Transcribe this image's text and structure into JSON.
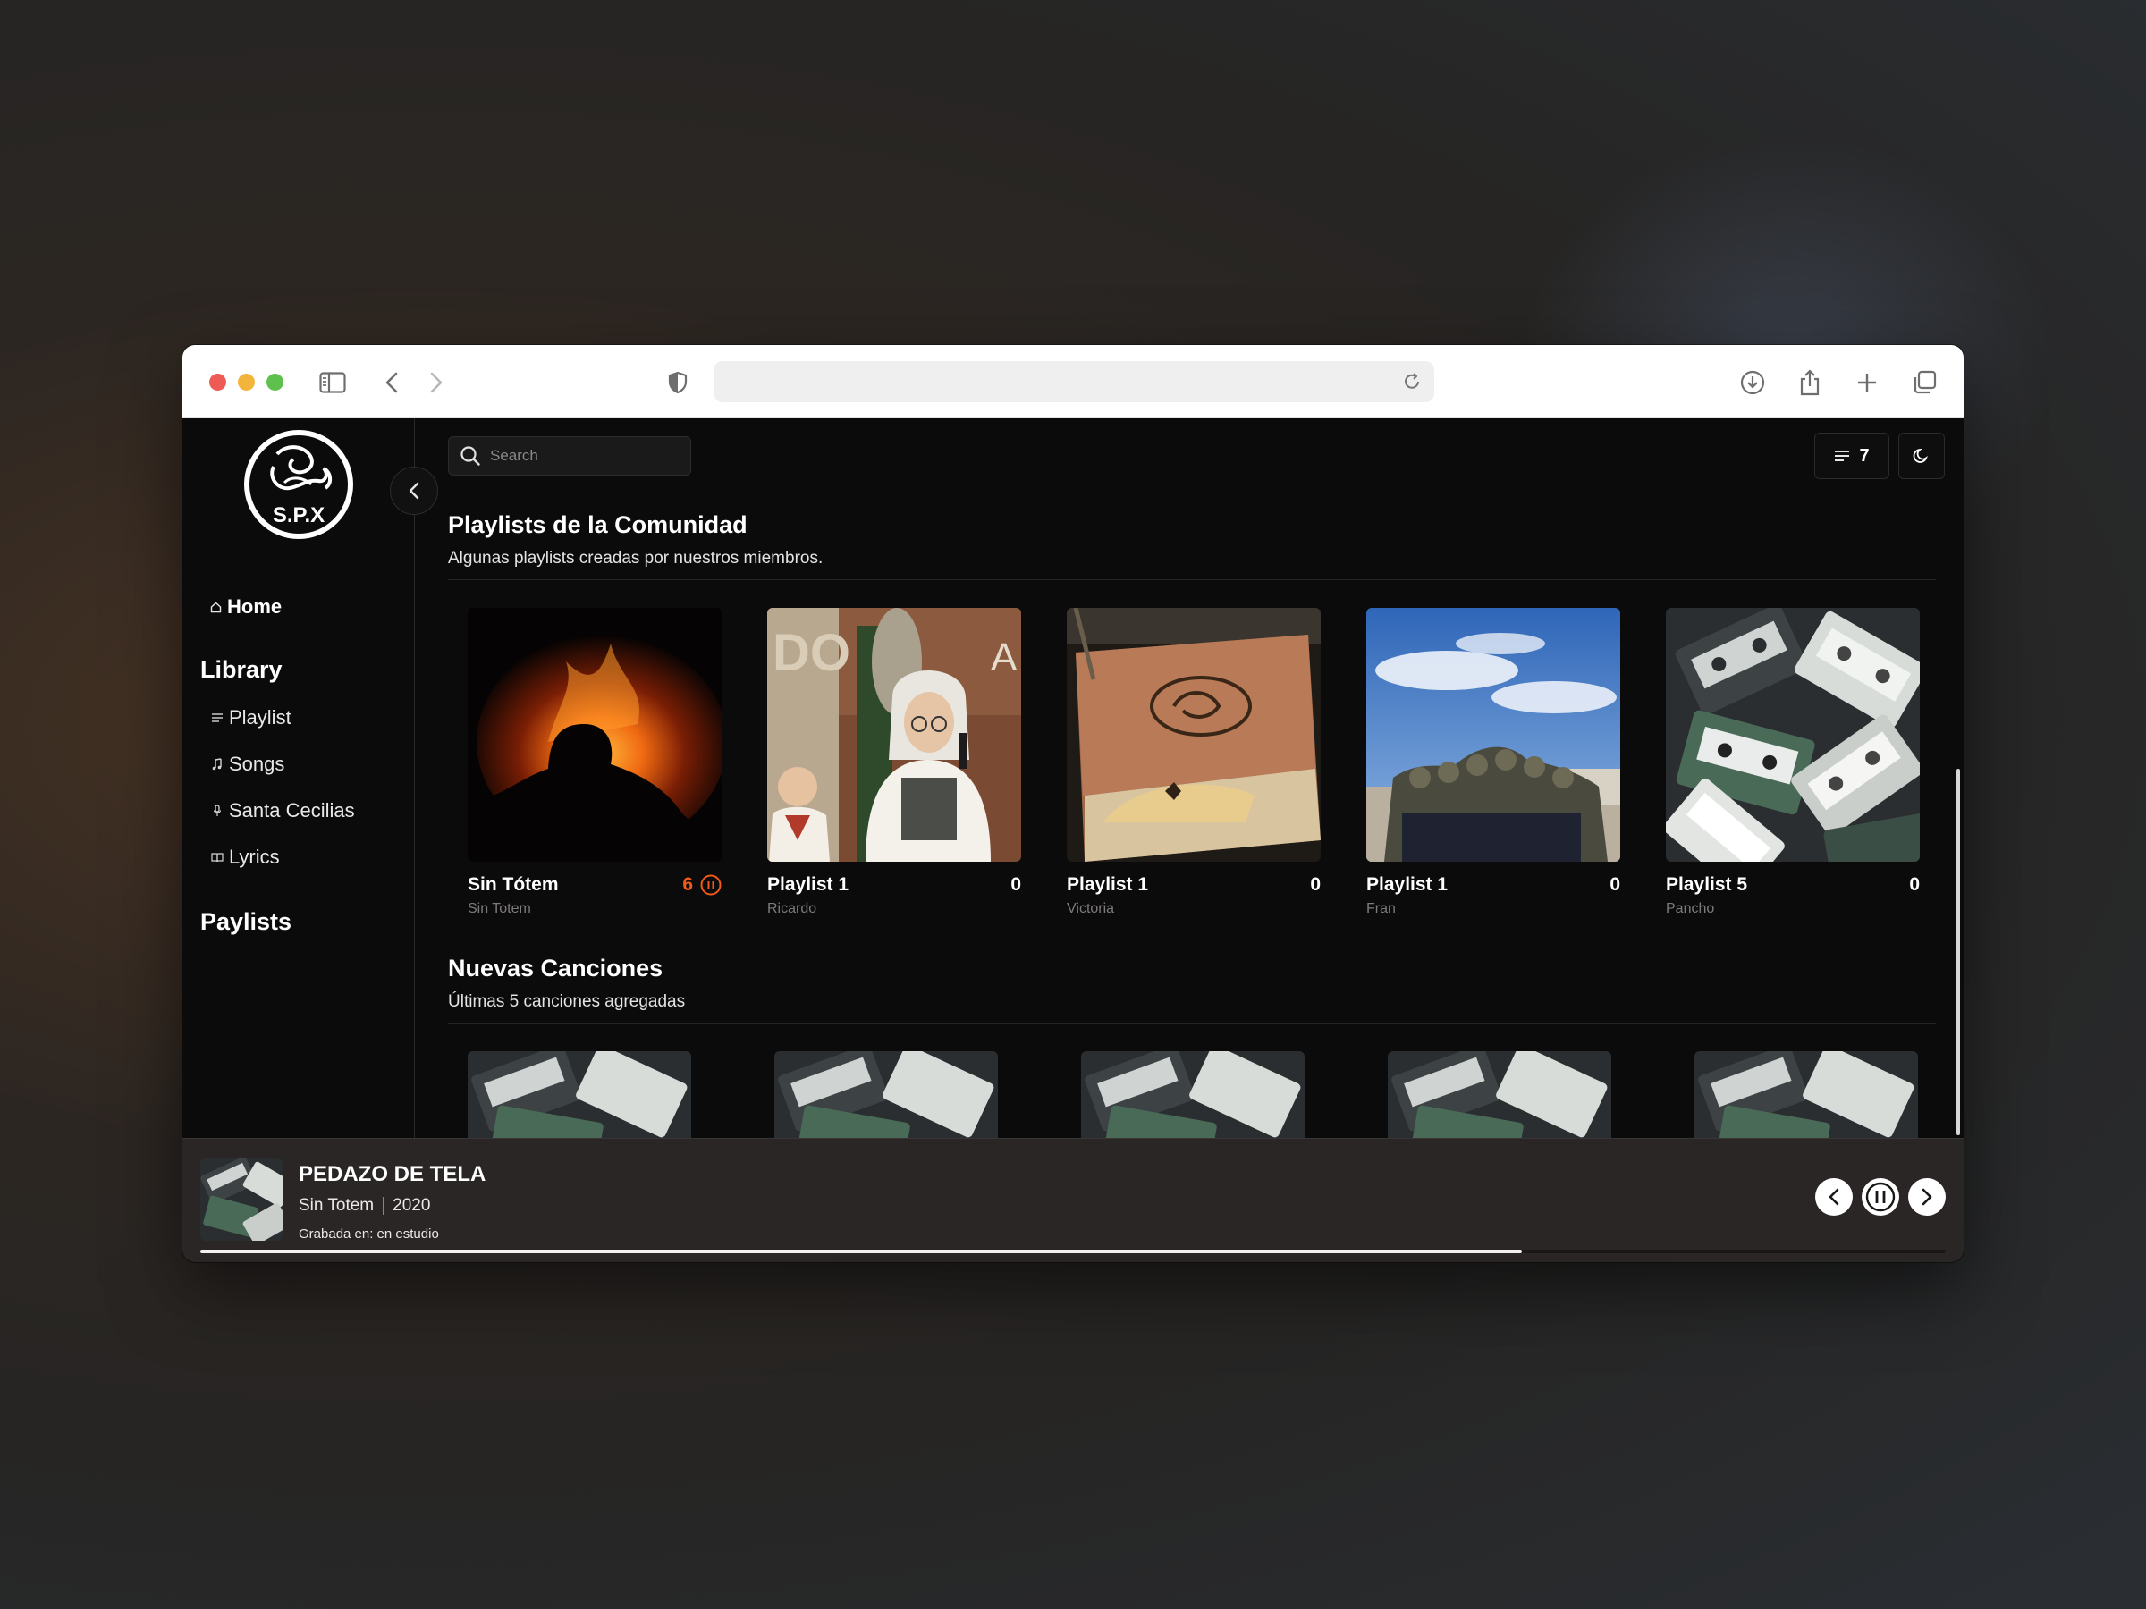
{
  "app": {
    "logo_text": "S.P.X",
    "search_placeholder": "Search",
    "queue_count": "7"
  },
  "sidebar": {
    "home_label": "Home",
    "library_title": "Library",
    "library_items": [
      {
        "label": "Playlist",
        "icon": "list-icon"
      },
      {
        "label": "Songs",
        "icon": "music-note-icon"
      },
      {
        "label": "Santa Cecilias",
        "icon": "microphone-icon"
      },
      {
        "label": "Lyrics",
        "icon": "book-icon"
      }
    ],
    "paylists_title": "Paylists"
  },
  "community": {
    "title": "Playlists de la Comunidad",
    "subtitle": "Algunas playlists creadas por nuestros miembros.",
    "playlists": [
      {
        "title": "Sin Tótem",
        "count": "6",
        "owner": "Sin Totem",
        "playing": true,
        "cover": "bonfire"
      },
      {
        "title": "Playlist 1",
        "count": "0",
        "owner": "Ricardo",
        "playing": false,
        "cover": "portrait"
      },
      {
        "title": "Playlist 1",
        "count": "0",
        "owner": "Victoria",
        "playing": false,
        "cover": "book"
      },
      {
        "title": "Playlist 1",
        "count": "0",
        "owner": "Fran",
        "playing": false,
        "cover": "group"
      },
      {
        "title": "Playlist 5",
        "count": "0",
        "owner": "Pancho",
        "playing": false,
        "cover": "cassettes"
      }
    ]
  },
  "new_songs": {
    "title": "Nuevas Canciones",
    "subtitle": "Últimas 5 canciones agregadas"
  },
  "player": {
    "title": "PEDAZO DE TELA",
    "artist": "Sin Totem",
    "year": "2020",
    "recorded": "Grabada en: en estudio",
    "progress": 0.757
  },
  "colors": {
    "accent": "#f05a1a",
    "background": "#0c0b0b",
    "player_bg": "#2a2626"
  }
}
